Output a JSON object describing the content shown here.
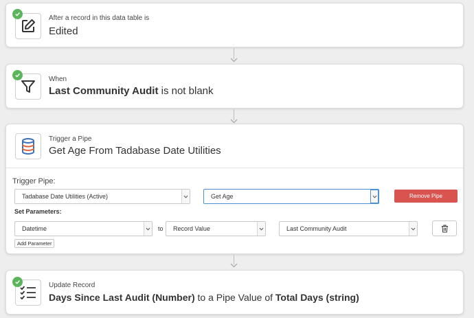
{
  "trigger": {
    "subtitle": "After a record in this data table is",
    "title": "Edited",
    "icon": "edit-icon"
  },
  "condition": {
    "subtitle": "When",
    "field": "Last Community Audit",
    "rest": " is not blank",
    "icon": "filter-icon"
  },
  "pipe": {
    "subtitle": "Trigger a Pipe",
    "title": "Get Age From Tadabase Date Utilities",
    "icon": "database-icon",
    "trigger_pipe_label": "Trigger Pipe:",
    "pipe_select": "Tadabase Date Utilities (Active)",
    "function_select": "Get Age",
    "remove_label": "Remove Pipe",
    "set_params_label": "Set Parameters:",
    "param_name": "Datetime",
    "to_label": "to",
    "value_type": "Record Value",
    "value_field": "Last Community Audit",
    "add_param_label": "Add Parameter"
  },
  "update": {
    "subtitle": "Update Record",
    "field": "Days Since Last Audit (Number)",
    "middle": " to a Pipe Value of ",
    "value": "Total Days (string)",
    "icon": "list-check-icon"
  },
  "colors": {
    "check": "#5bb55b",
    "remove": "#d9534f",
    "focus": "#4a90d9"
  }
}
